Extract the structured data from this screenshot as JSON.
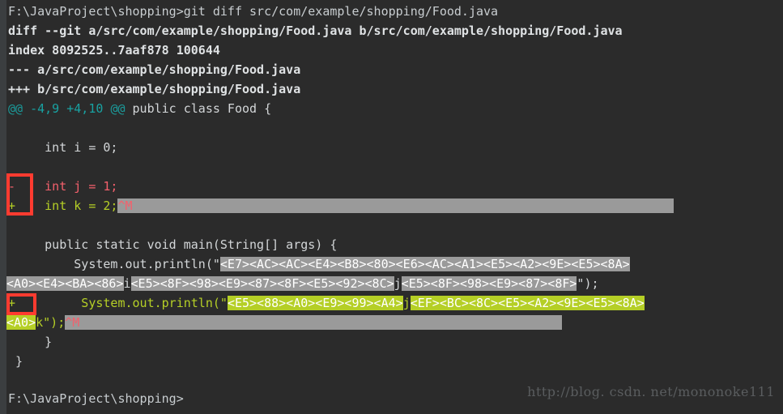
{
  "terminal": {
    "background": "#2b2b2b",
    "left_edge_color": "#3b3e40",
    "font_color": "#d6d6d6",
    "annotation_box_color": "#ff3b30",
    "highlight_gray": "#9a9a9a",
    "highlight_green": "#b5cf26",
    "prompt_command": {
      "prompt": "F:\\JavaProject\\shopping>",
      "command": "git diff src/com/example/shopping/Food.java"
    },
    "diff_header": {
      "line_diff": "diff --git a/src/com/example/shopping/Food.java b/src/com/example/shopping/Food.java",
      "line_index": "index 8092525..7aaf878 100644",
      "line_minus_file": "--- a/src/com/example/shopping/Food.java",
      "line_plus_file": "+++ b/src/com/example/shopping/Food.java",
      "hunk_at_left": "@@",
      "hunk_range": " -4,9 +4,10 ",
      "hunk_at_right": "@@",
      "hunk_context": " public class Food {"
    },
    "body": {
      "blank1": "",
      "ctx_int_i": "     int i = 0;",
      "blank2": "",
      "removed_marker": "-",
      "removed_text": "    int j = 1;",
      "added_marker": "+",
      "added_text": "    int k = 2;",
      "added_cr": "^M",
      "blank3": "",
      "ctx_main": "     public static void main(String[] args) {",
      "ctx_println_indent": "         System.out.println(\"",
      "ctx_hex_part1": "<E7><AC><AC><E4><B8><80><E6><AC><A1><E5><A2><9E><E5><8A>",
      "ctx_hex_part2": "<A0><E4><BA><86>",
      "ctx_char_i": "i",
      "ctx_hex_part3": "<E5><8F><98><E9><87><8F><E5><92><8C>",
      "ctx_char_j": "j",
      "ctx_hex_part4": "<E5><8F><98><E9><87><8F>",
      "ctx_quote_end": "\");",
      "add2_marker": "+",
      "add2_println_indent": "         System.out.println(\"",
      "add2_hex_part1": "<E5><88><A0><E9><99><A4>",
      "add2_char_j": "j",
      "add2_hex_part2": "<EF><BC><8C><E5><A2><9E><E5><8A>",
      "add2_hex_part3": "<A0>",
      "add2_tail": "k\");",
      "add2_cr": "^M",
      "ctx_close_inner": "     }",
      "ctx_close_outer": " }",
      "blank4": ""
    },
    "final_prompt": "F:\\JavaProject\\shopping>",
    "watermark": "http://blog. csdn. net/mononoke111"
  }
}
